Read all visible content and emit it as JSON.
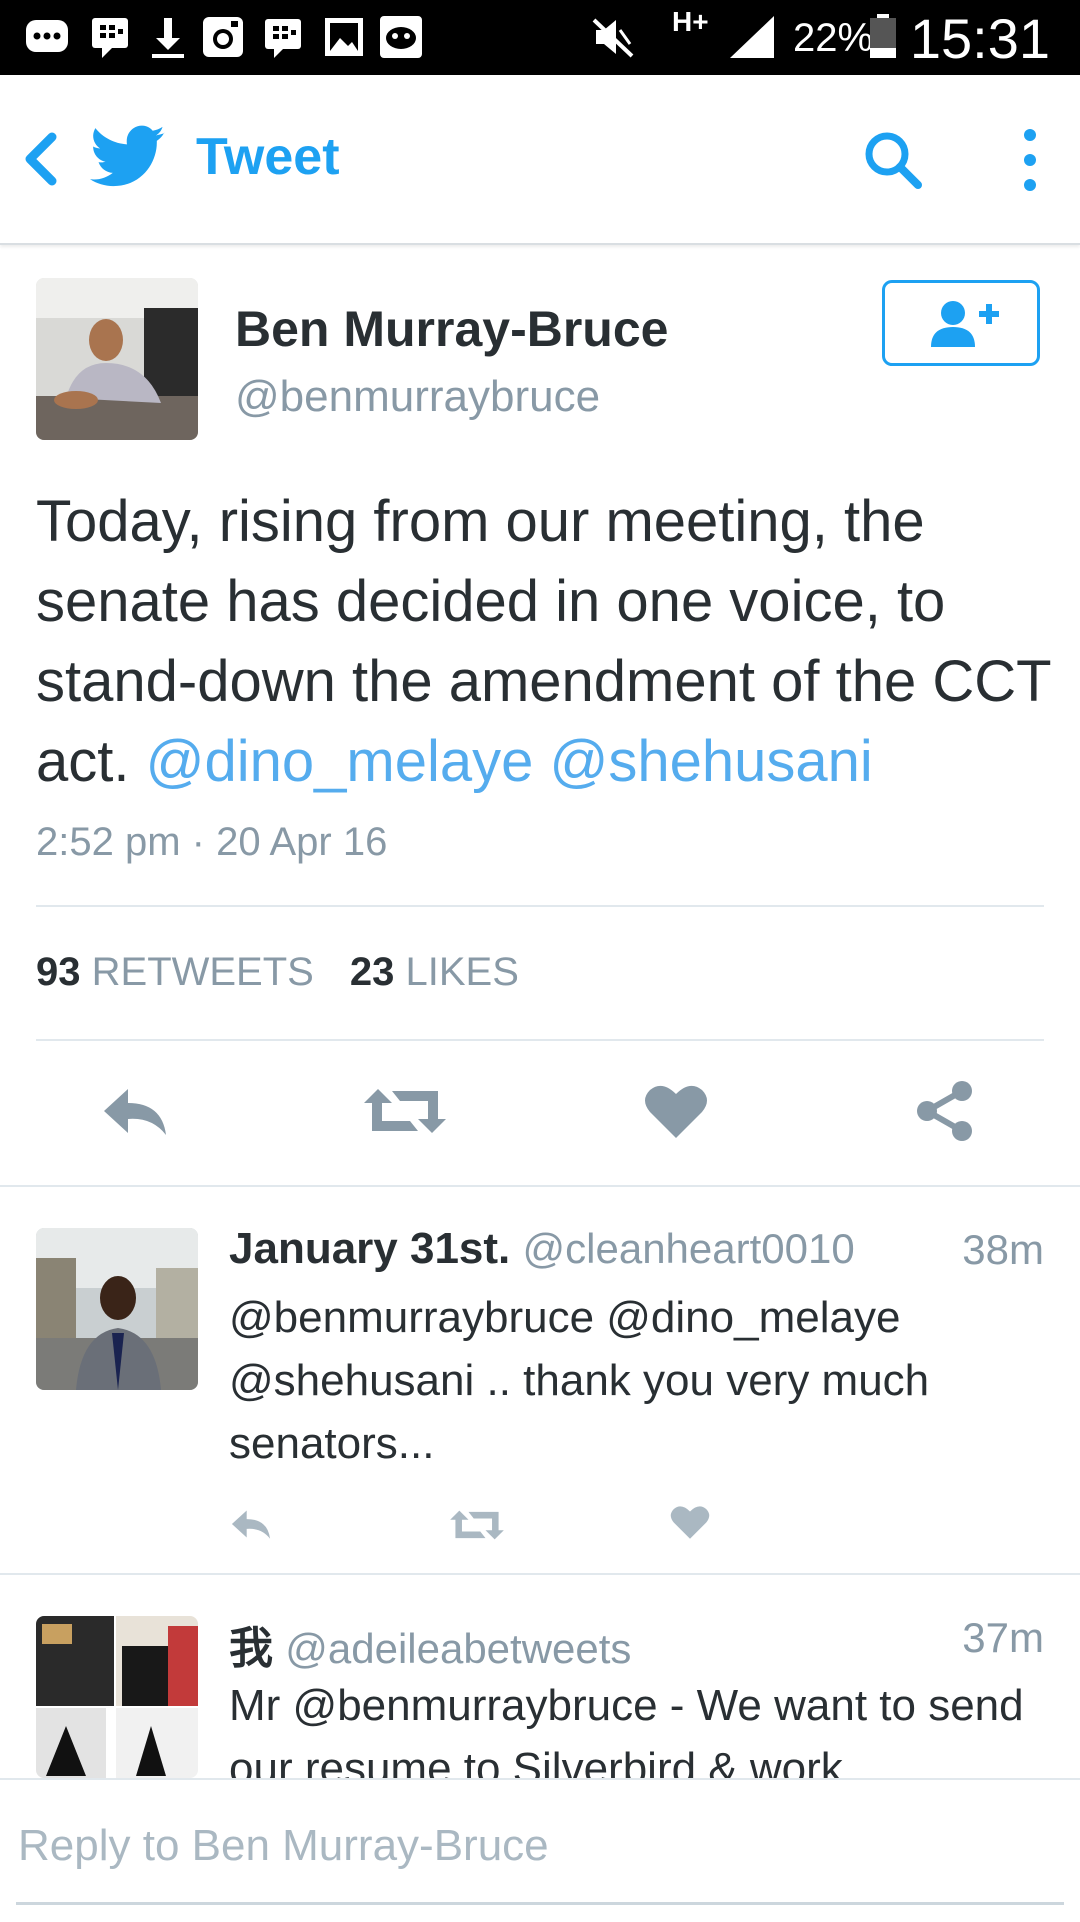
{
  "status_bar": {
    "time": "15:31",
    "battery": "22%",
    "network": "H+",
    "icons": [
      "bbm-icon",
      "bbm-chat-icon",
      "download-icon",
      "instagram-icon",
      "bbm-icon-2",
      "gallery-icon",
      "game-icon",
      "mute-icon",
      "signal-icon",
      "battery-icon"
    ]
  },
  "app_bar": {
    "title": "Tweet",
    "accent": "#1da1f2"
  },
  "tweet": {
    "author_name": "Ben Murray-Bruce",
    "author_handle": "@benmurraybruce",
    "text_plain": "Today, rising from our meeting, the senate has decided in one voice, to stand-down the amendment of the CCT act. ",
    "mention_1": "@dino_melaye",
    "mention_2": "@shehusani",
    "timestamp": "2:52 pm · 20 Apr 16",
    "retweets_count": "93",
    "retweets_label": "RETWEETS",
    "likes_count": "23",
    "likes_label": "LIKES"
  },
  "replies": [
    {
      "name": "January 31st.",
      "handle": "@cleanheart0010",
      "time": "38m",
      "text": "@benmurraybruce @dino_melaye @shehusani .. thank you very much senators..."
    },
    {
      "name": "我",
      "handle": "@adeileabetweets",
      "time": "37m",
      "text": "Mr @benmurraybruce - We want to send our resume to Silverbird & work"
    }
  ],
  "reply_box": {
    "placeholder": "Reply to Ben Murray-Bruce"
  },
  "colors": {
    "link": "#55acee",
    "muted": "#8899a6",
    "icon_gray": "#8899a6"
  }
}
